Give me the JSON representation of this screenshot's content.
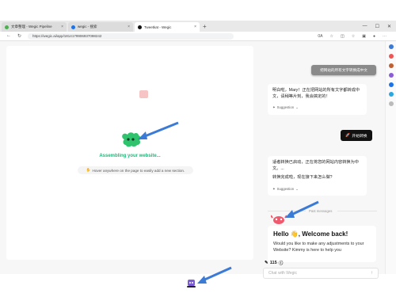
{
  "tabs": [
    {
      "label": "文章整理 - Wegic Pipeline",
      "active": false
    },
    {
      "label": "wegic - 搜索",
      "active": false
    },
    {
      "label": "Tweetkat - Wegic",
      "active": true
    }
  ],
  "address": {
    "url": "https://wegic.ai/app/1814179906937098242",
    "zoom": "0A"
  },
  "canvas": {
    "status": "Assembling your website...",
    "hint": "Hover anywhere on the page to easily add a new section."
  },
  "chat": {
    "top_button": "把网站的所有文字转换成中文",
    "msg1": "明白啦，Mary！正在把网站的所有文字都转成中文，请稍等片刻，我会搞定的！",
    "suggestion": "Suggestion",
    "black_button": "开始转换",
    "msg2_line1": "适者转换已启动，正在将您的网站内容转换为中文。...",
    "msg2_line2": "转换完成啦，现在接下来怎么做?",
    "past": "Past messages",
    "welcome_title": "Hello 👋, Welcome back!",
    "welcome_body": "Would you like to make any adjustments to your Website? Kimmy is here to help you",
    "credits": "115",
    "input_placeholder": "Chat with Wegic"
  },
  "colors": {
    "accent_green": "#1db97a",
    "brand_black": "#111111"
  }
}
